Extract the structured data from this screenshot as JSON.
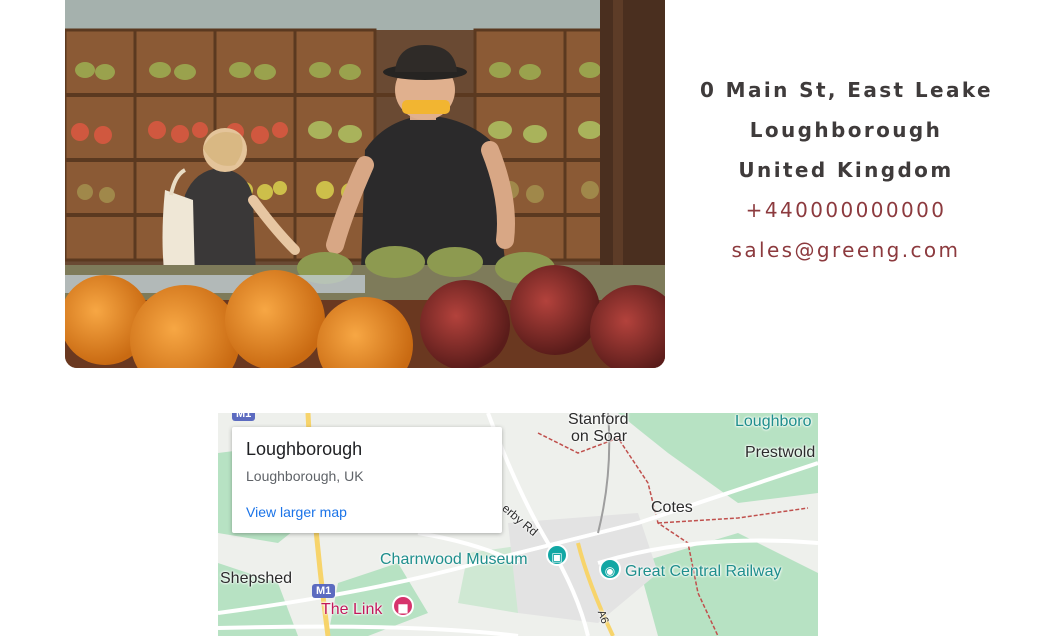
{
  "contact": {
    "address_line1": "0 Main St, East Leake",
    "address_line2": "Loughborough",
    "address_line3": "United Kingdom",
    "phone": "+440000000000",
    "email": "sales@greeng.com"
  },
  "map": {
    "place_title": "Loughborough",
    "place_subtitle": "Loughborough, UK",
    "view_larger_label": "View larger map",
    "labels": {
      "stanford1": "Stanford",
      "stanford2": "on Soar",
      "loughborough_corner": "Loughboro",
      "prestwold": "Prestwold",
      "cotes": "Cotes",
      "charnwood_museum": "Charnwood Museum",
      "great_central_railway": "Great Central Railway",
      "shepshed": "Shepshed",
      "the_link": "The Link",
      "m1": "M1",
      "a6": "A6",
      "road_rd": "erby Rd"
    }
  },
  "colors": {
    "accent": "#8c3a3e",
    "text_dark": "#3f3b3b",
    "map_link": "#1a73e8",
    "map_park": "#b7e2c3",
    "map_road_yellow": "#f7d46b"
  }
}
